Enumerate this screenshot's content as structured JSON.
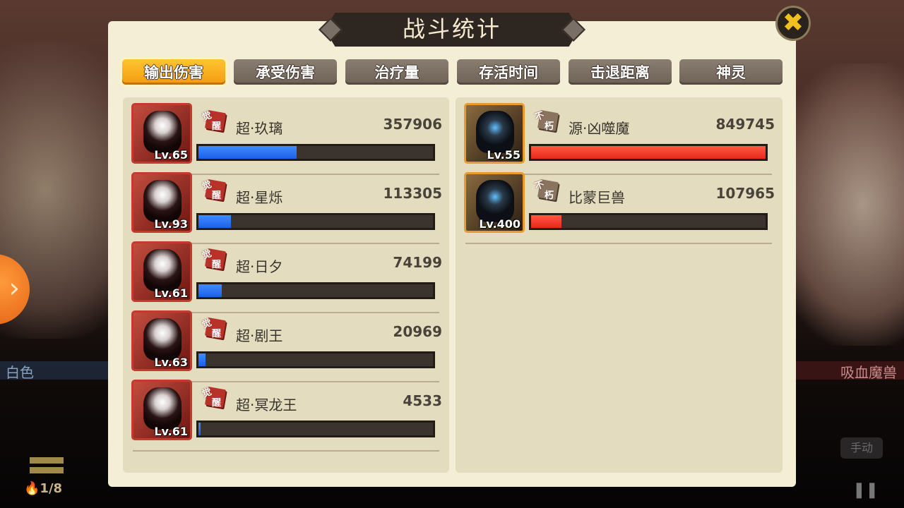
{
  "title": "战斗统计",
  "close_icon_glyph": "✖",
  "tabs": [
    {
      "label": "输出伤害",
      "active": true
    },
    {
      "label": "承受伤害",
      "active": false
    },
    {
      "label": "治疗量",
      "active": false
    },
    {
      "label": "存活时间",
      "active": false
    },
    {
      "label": "击退距离",
      "active": false
    },
    {
      "label": "神灵",
      "active": false
    }
  ],
  "left_team": [
    {
      "name": "超·玖璃",
      "level": "Lv.65",
      "value": "357906",
      "badge": [
        "觉",
        "醒"
      ],
      "fill": 0.42
    },
    {
      "name": "超·星烁",
      "level": "Lv.93",
      "value": "113305",
      "badge": [
        "觉",
        "醒"
      ],
      "fill": 0.14
    },
    {
      "name": "超·日夕",
      "level": "Lv.61",
      "value": "74199",
      "badge": [
        "觉",
        "醒"
      ],
      "fill": 0.1
    },
    {
      "name": "超·剧王",
      "level": "Lv.63",
      "value": "20969",
      "badge": [
        "觉",
        "醒"
      ],
      "fill": 0.03
    },
    {
      "name": "超·冥龙王",
      "level": "Lv.61",
      "value": "4533",
      "badge": [
        "觉",
        "醒"
      ],
      "fill": 0.01
    }
  ],
  "right_team": [
    {
      "name": "源·凶噬魔",
      "level": "Lv.55",
      "value": "849745",
      "badge": [
        "不",
        "朽"
      ],
      "fill": 1.0
    },
    {
      "name": "比蒙巨兽",
      "level": "Lv.400",
      "value": "107965",
      "badge": [
        "不",
        "朽"
      ],
      "fill": 0.13
    }
  ],
  "background": {
    "left_label": "白色",
    "right_label": "吸血魔兽",
    "energy": "1/8",
    "manual_button": "手动",
    "pause_glyph": "❚❚",
    "arrow_glyph": "›"
  },
  "colors": {
    "player_bar": "#2f6ff0",
    "enemy_bar": "#f03a2a",
    "active_tab": "#f7a91e",
    "panel": "#f4eed6"
  }
}
